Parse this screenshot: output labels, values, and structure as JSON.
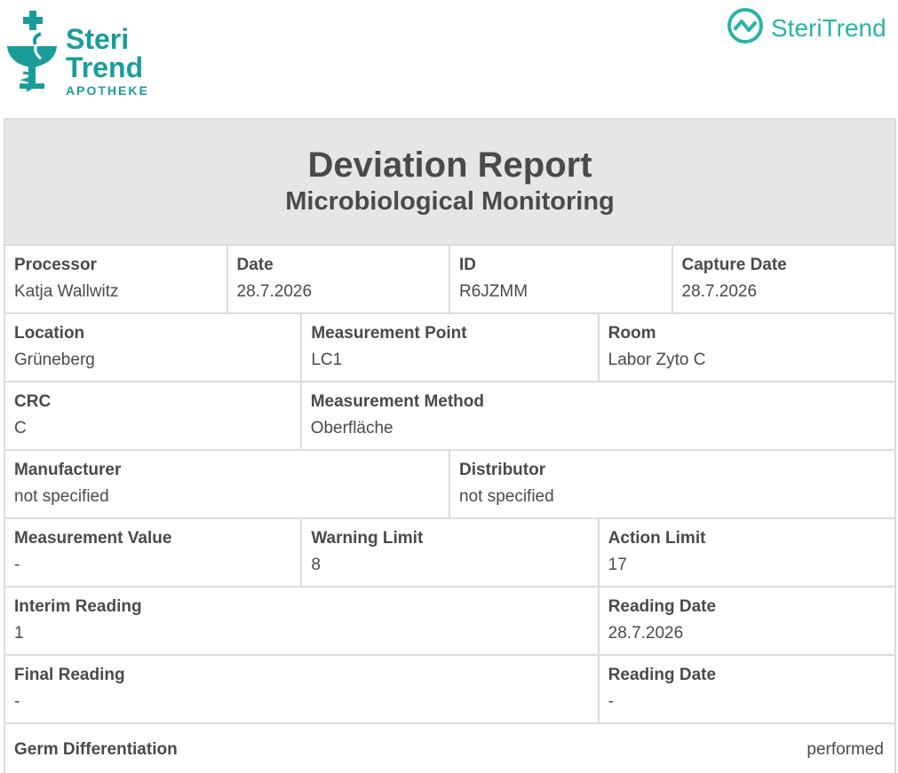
{
  "logo_left": {
    "line1": "Steri",
    "line2": "Trend",
    "line3": "APOTHEKE",
    "icon": "pharmacy-caduceus-icon",
    "color": "#1a9d9a"
  },
  "logo_right": {
    "text": "SteriTrend",
    "icon": "trend-circle-icon",
    "color": "#2ab3a8"
  },
  "report": {
    "title": "Deviation Report",
    "subtitle": "Microbiological Monitoring",
    "rows": [
      [
        {
          "label": "Processor",
          "value": "Katja Wallwitz"
        },
        {
          "label": "Date",
          "value": "28.7.2026"
        },
        {
          "label": "ID",
          "value": "R6JZMM"
        },
        {
          "label": "Capture Date",
          "value": "28.7.2026"
        }
      ],
      [
        {
          "label": "Location",
          "value": "Grüneberg"
        },
        {
          "label": "Measurement Point",
          "value": "LC1"
        },
        {
          "label": "Room",
          "value": "Labor Zyto C"
        }
      ],
      [
        {
          "label": "CRC",
          "value": "C"
        },
        {
          "label": "Measurement Method",
          "value": "Oberfläche"
        }
      ],
      [
        {
          "label": "Manufacturer",
          "value": "not specified"
        },
        {
          "label": "Distributor",
          "value": "not specified"
        }
      ],
      [
        {
          "label": "Measurement Value",
          "value": "-"
        },
        {
          "label": "Warning Limit",
          "value": "8"
        },
        {
          "label": "Action Limit",
          "value": "17"
        }
      ],
      [
        {
          "label": "Interim Reading",
          "value": "1"
        },
        {
          "label": "Reading Date",
          "value": "28.7.2026"
        }
      ],
      [
        {
          "label": "Final Reading",
          "value": "-"
        },
        {
          "label": "Reading Date",
          "value": "-"
        }
      ]
    ],
    "germ_differentiation": {
      "label": "Germ Differentiation",
      "value": "performed"
    }
  }
}
